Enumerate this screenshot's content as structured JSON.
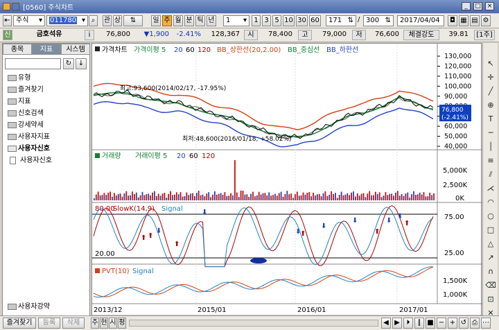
{
  "window": {
    "title": "[0560] 주식차트",
    "btn_min": "_",
    "btn_max": "□",
    "btn_close": "×"
  },
  "toolbar": {
    "market": "주식",
    "code": "011780",
    "b_gwan": "관",
    "b_sang": "상",
    "period_buttons": [
      "일",
      "주",
      "월",
      "분",
      "틱",
      "년"
    ],
    "count_sel": "1",
    "num_buttons": [
      "1",
      "3",
      "5",
      "10",
      "30",
      "60"
    ],
    "range_current": "171",
    "range_sep": "/",
    "range_total": "300",
    "date": "2017/04/04"
  },
  "quote": {
    "badge": "신",
    "name": "금호석유",
    "info": "i",
    "price": "76,800",
    "change": "▼1,900",
    "rate": "-2.41%",
    "volume": "128,367",
    "open_label": "시",
    "open": "78,400",
    "high_label": "고",
    "high": "79,000",
    "low_label": "저",
    "low": "76,600",
    "strength_label": "체결강도",
    "strength": "39.81",
    "unit": "[1주]"
  },
  "sidebar": {
    "tabs": [
      "종목",
      "지표",
      "시스템"
    ],
    "items": [
      "유형",
      "즐겨찾기",
      "지표",
      "신호검색",
      "강세약세",
      "사용자지표",
      "사용자신호"
    ],
    "sub_item": "사용자신호",
    "bottom_item": "사용자강약"
  },
  "chart_data": [
    {
      "type": "line",
      "title": "가격차트",
      "legend": [
        "가격이평 5",
        "20",
        "60",
        "120",
        "BB_상한선(20,2.00)",
        "BB_중심선",
        "BB_하한선"
      ],
      "ylim": [
        40000,
        130000
      ],
      "y_ticks": [
        "130,000",
        "120,000",
        "110,000",
        "100,000",
        "90,000",
        "80,000",
        "70,000",
        "60,000",
        "50,000",
        "40,000"
      ],
      "x_ticks": [
        "2013/12",
        "2015/01",
        "2016/01",
        "2017/01"
      ],
      "annotations": [
        "최고:93,600(2014/02/17, -17.95%)",
        "최저:48,600(2016/01/18, +58.02%)"
      ],
      "last_price_box": [
        "76,800",
        "(-2.41%)"
      ],
      "series": [
        {
          "name": "가격",
          "values": [
            90000,
            92000,
            93600,
            88000,
            85000,
            83000,
            78000,
            72000,
            68000,
            62000,
            55000,
            50000,
            48600,
            54000,
            62000,
            70000,
            74000,
            80000,
            88000,
            82000,
            76800
          ]
        }
      ]
    },
    {
      "type": "bar",
      "title": "거래량",
      "legend": [
        "거래이평 5",
        "20",
        "60",
        "120"
      ],
      "y_ticks": [
        "5,000K",
        "2,500K",
        "0K"
      ]
    },
    {
      "type": "line",
      "title": "SlowK(14,9)",
      "legend": [
        "Signal"
      ],
      "ylim": [
        0,
        100
      ],
      "y_ticks": [
        "75.00",
        "25.00"
      ],
      "marks": [
        "80.00",
        "20.00"
      ]
    },
    {
      "type": "line",
      "title": "PVT(10)",
      "legend": [
        "Signal"
      ],
      "y_ticks": [
        "1,500K",
        "1,000K"
      ]
    }
  ],
  "bottom": {
    "fav": "즐겨찾기",
    "reg": "등록",
    "del": "삭제",
    "tabs": [
      "주",
      "현",
      "시",
      "평"
    ]
  },
  "colors": {
    "accent": "#f0b040",
    "title_bar": "#4a6aa8",
    "bb_upper": "#d04010",
    "bb_mid": "#108030",
    "bb_lower": "#2040c0",
    "price": "#000000"
  }
}
